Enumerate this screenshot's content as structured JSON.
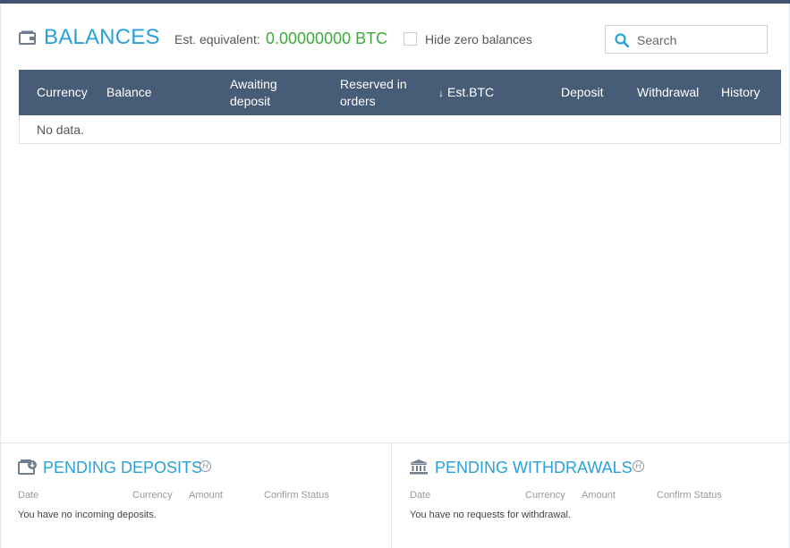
{
  "balances": {
    "title": "BALANCES",
    "est_label": "Est. equivalent:",
    "est_value": "0.00000000 BTC",
    "hide_zero_label": "Hide zero balances",
    "search_placeholder": "Search"
  },
  "table": {
    "columns": {
      "currency": "Currency",
      "balance": "Balance",
      "awaiting_1": "Awaiting",
      "awaiting_2": "deposit",
      "reserved_1": "Reserved in",
      "reserved_2": "orders",
      "sort_arrow": "↓",
      "est_btc": "Est.BTC",
      "deposit": "Deposit",
      "withdrawal": "Withdrawal",
      "history": "History"
    },
    "empty": "No data."
  },
  "pending_deposits": {
    "title": "PENDING DEPOSITS",
    "help": "H",
    "columns": {
      "date": "Date",
      "currency": "Currency",
      "amount": "Amount",
      "status": "Confirm Status"
    },
    "empty": "You have no incoming deposits."
  },
  "pending_withdrawals": {
    "title": "PENDING WITHDRAWALS",
    "help": "H",
    "columns": {
      "date": "Date",
      "currency": "Currency",
      "amount": "Amount",
      "status": "Confirm Status"
    },
    "empty": "You have no requests for withdrawal."
  },
  "icons": {
    "wallet": "wallet-icon",
    "search": "search-icon",
    "deposit": "wallet-deposit-icon",
    "bank": "bank-icon",
    "help": "help-icon"
  },
  "colors": {
    "accent": "#2aa0d8",
    "header": "#475c76",
    "positive": "#3daa3d"
  }
}
